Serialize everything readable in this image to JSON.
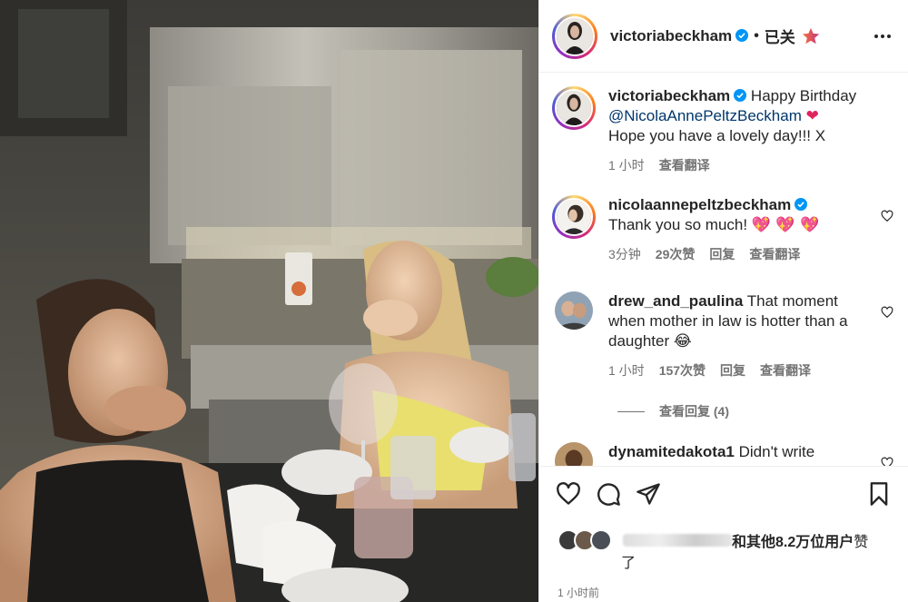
{
  "post": {
    "author": "victoriabeckham",
    "follow_status": "已关注",
    "caption_text_1": "Happy Birthday",
    "caption_mention": "@NicolaAnnePeltzBeckham",
    "caption_emoji_1": "❤",
    "caption_text_2": "Hope you have a lovely day!!! X",
    "caption_time": "1 小时",
    "caption_translate": "查看翻译"
  },
  "comments": [
    {
      "user": "nicolaannepeltzbeckham",
      "text": "Thank you so much!",
      "emoji": "💖 💖 💖",
      "time": "3分钟",
      "likes": "29次赞",
      "reply": "回复",
      "translate": "查看翻译"
    },
    {
      "user": "drew_and_paulina",
      "text": "That moment when mother in law is hotter than a daughter",
      "emoji": "😂",
      "time": "1 小时",
      "likes": "157次赞",
      "reply": "回复",
      "translate": "查看翻译",
      "view_replies": "查看回复 (4)"
    },
    {
      "user": "dynamitedakota1",
      "text": "Didn't write"
    }
  ],
  "likes": {
    "summary": "和其他8.2万位用户",
    "suffix_1": "赞",
    "suffix_2": "了"
  },
  "posted_time": "1 小时前",
  "colors": {
    "link": "#00376b",
    "verified": "#0095f6",
    "meta": "#737373",
    "text": "#262626"
  }
}
